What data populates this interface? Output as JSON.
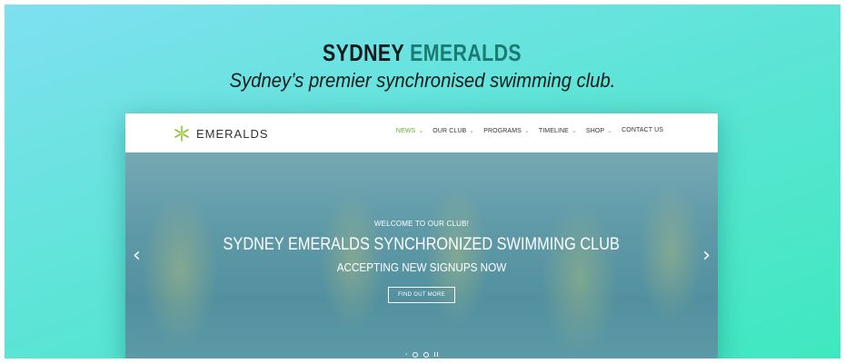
{
  "header": {
    "title_part1": "SYDNEY",
    "title_part2": "EMERALDS",
    "tagline": "Sydney’s premier synchronised swimming club."
  },
  "site": {
    "logo_text": "EMERALDS",
    "logo_icon": "star-flower-icon",
    "menu": [
      {
        "label": "NEWS",
        "active": true,
        "dropdown": true
      },
      {
        "label": "OUR CLUB",
        "active": false,
        "dropdown": true
      },
      {
        "label": "PROGRAMS",
        "active": false,
        "dropdown": true
      },
      {
        "label": "TIMELINE",
        "active": false,
        "dropdown": true
      },
      {
        "label": "SHOP",
        "active": false,
        "dropdown": true
      },
      {
        "label": "CONTACT US",
        "active": false,
        "dropdown": false
      }
    ],
    "hero": {
      "kicker": "WELCOME TO OUR CLUB!",
      "title": "SYDNEY EMERALDS SYNCHRONIZED SWIMMING CLUB",
      "subtitle": "ACCEPTING NEW SIGNUPS NOW",
      "button": "FIND OUT MORE",
      "prev_icon": "chevron-left-icon",
      "next_icon": "chevron-right-icon"
    }
  },
  "colors": {
    "accent_green": "#1c7a70",
    "nav_active": "#6aa832"
  }
}
